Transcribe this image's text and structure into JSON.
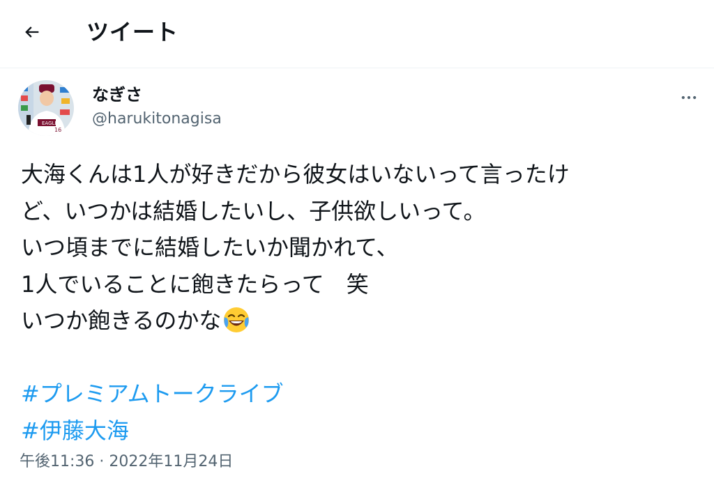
{
  "header": {
    "title": "ツイート",
    "back_icon": "back-arrow-icon"
  },
  "author": {
    "display_name": "なぎさ",
    "handle": "@harukitonagisa",
    "avatar": "avatar-photo"
  },
  "tweet": {
    "lines": [
      "大海くんは1人が好きだから彼女はいないって言ったけ",
      "ど、いつかは結婚したいし、子供欲しいって。",
      "いつ頃までに結婚したいか聞かれて、",
      "1人でいることに飽きたらって　笑",
      "いつか飽きるのかな"
    ],
    "emoji": "face-with-tears-of-joy-emoji",
    "hashtags": [
      "#プレミアムトークライブ",
      "#伊藤大海"
    ]
  },
  "meta": {
    "time": "午後11:36",
    "separator": "·",
    "date": "2022年11月24日"
  },
  "colors": {
    "text": "#0f1419",
    "secondary": "#536471",
    "link": "#1d9bf0"
  }
}
